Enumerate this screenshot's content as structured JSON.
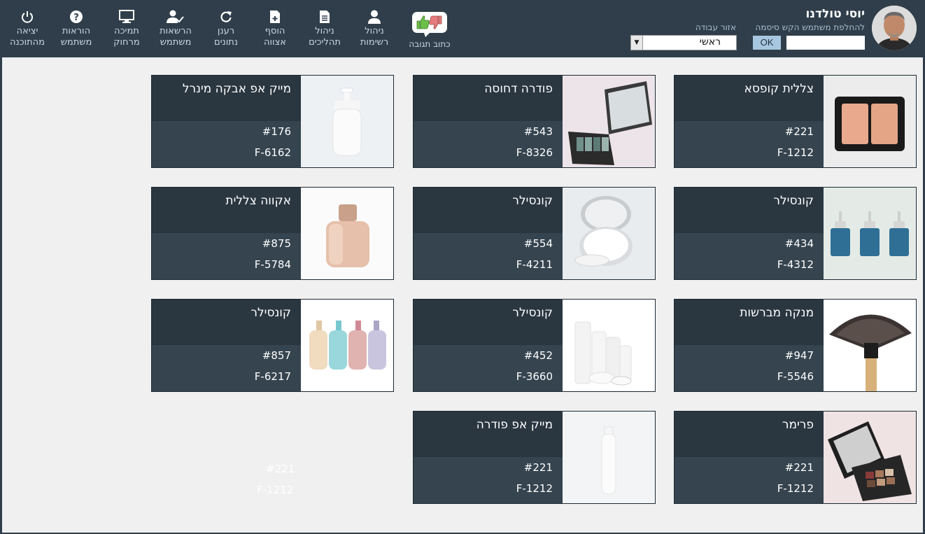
{
  "toolbar": {
    "exit": [
      "יציאה",
      "מהתוכנה"
    ],
    "help": [
      "הוראות",
      "משתמש"
    ],
    "remote": [
      "תמיכה",
      "מרחוק"
    ],
    "permissions": [
      "הרשאות",
      "משתמש"
    ],
    "refresh": [
      "רענן",
      "נתונים"
    ],
    "add": [
      "הוסף",
      "אצווה"
    ],
    "processes": [
      "ניהול",
      "תהליכים"
    ],
    "lists": [
      "ניהול",
      "רשימות"
    ],
    "feedback": "כתוב תגובה"
  },
  "work_area": {
    "label": "אזור עבודה",
    "selected": "ראשי"
  },
  "user": {
    "name": "יוסי טולדנו",
    "change_password": "להחלפת משתמש הקש סיסמה",
    "ok_label": "OK"
  },
  "cards": [
    {
      "name": "צללית קופסא",
      "code": "#221",
      "ref": "F-1212",
      "image": "blush-compact"
    },
    {
      "name": "פודרה דחוסה",
      "code": "#543",
      "ref": "F-8326",
      "image": "eyeshadow-palette"
    },
    {
      "name": "מייק אפ אבקה מינרל",
      "code": "#176",
      "ref": "F-6162",
      "image": "pump-bottle"
    },
    {
      "name": "קונסילר",
      "code": "#434",
      "ref": "F-4312",
      "image": "blue-bottles"
    },
    {
      "name": "קונסילר",
      "code": "#554",
      "ref": "F-4211",
      "image": "cushion-compact"
    },
    {
      "name": "אקווה צללית",
      "code": "#875",
      "ref": "F-5784",
      "image": "foundation-bottle"
    },
    {
      "name": "מנקה מברשות",
      "code": "#947",
      "ref": "F-5546",
      "image": "fan-brush"
    },
    {
      "name": "קונסילר",
      "code": "#452",
      "ref": "F-3660",
      "image": "white-bottles"
    },
    {
      "name": "קונסילר",
      "code": "#857",
      "ref": "F-6217",
      "image": "pastel-bottles"
    },
    {
      "name": "פרימר",
      "code": "#221",
      "ref": "F-1212",
      "image": "makeup-palette"
    },
    {
      "name": "מייק אפ פודרה",
      "code": "#221",
      "ref": "F-1212",
      "image": "tall-bottle"
    }
  ],
  "ghost_card": {
    "code": "#221",
    "ref": "F-1212"
  }
}
